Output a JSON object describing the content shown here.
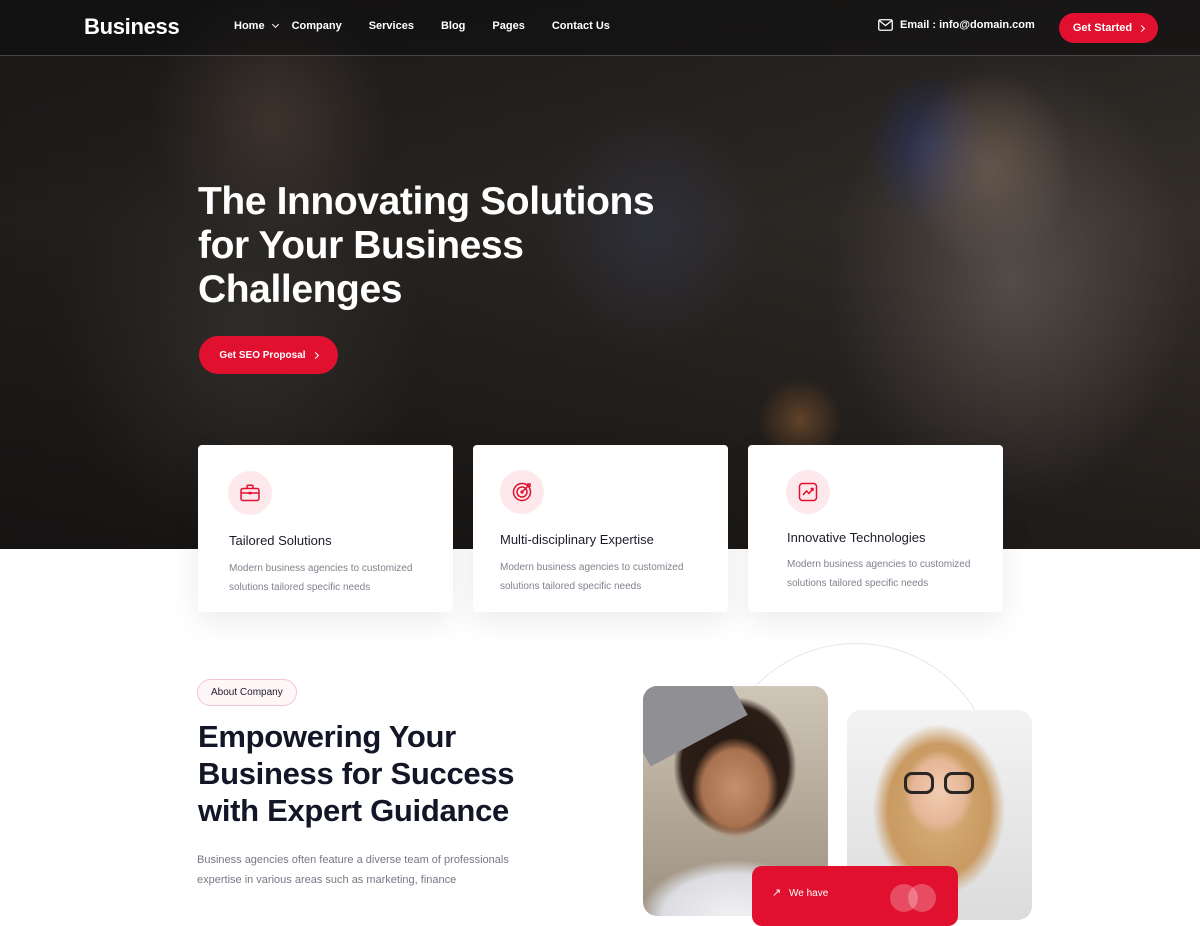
{
  "brand": {
    "logo": "Business",
    "accent_color": "#e0102e"
  },
  "nav": {
    "items": [
      "Home",
      "Company",
      "Services",
      "Blog",
      "Pages",
      "Contact Us"
    ],
    "email": "Email : info@domain.com",
    "cta": "Get Started"
  },
  "hero": {
    "title": "The Innovating Solutions for Your Business Challenges",
    "cta": "Get SEO Proposal"
  },
  "features": [
    {
      "icon": "briefcase-icon",
      "title": "Tailored Solutions",
      "desc": "Modern business agencies to customized solutions tailored specific needs"
    },
    {
      "icon": "target-icon",
      "title": "Multi-disciplinary Expertise",
      "desc": "Modern business agencies to customized solutions tailored specific needs"
    },
    {
      "icon": "chart-icon",
      "title": "Innovative Technologies",
      "desc": "Modern business agencies to customized solutions tailored specific needs"
    }
  ],
  "about": {
    "badge": "About Company",
    "title": "Empowering Your Business for Success with Expert Guidance",
    "desc": "Business agencies often feature a diverse team of professionals expertise in various areas such as marketing, finance",
    "stat_label": "We have"
  }
}
